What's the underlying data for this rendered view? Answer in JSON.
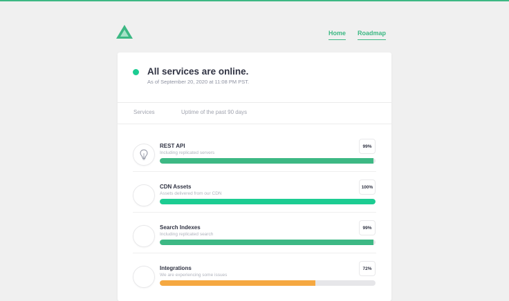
{
  "colors": {
    "accent": "#3db884",
    "online": "#1ccc92",
    "warning": "#f5a841"
  },
  "nav": {
    "home": "Home",
    "roadmap": "Roadmap"
  },
  "status": {
    "title": "All services are online.",
    "subtitle": "As of September 20, 2020 at 11:08 PM PST."
  },
  "table": {
    "col_services": "Services",
    "col_uptime": "Uptime of the past 90 days"
  },
  "services": [
    {
      "name": "REST API",
      "description": "Including replicated servers",
      "uptime_label": "99%",
      "uptime": 0.99,
      "color": "#3db884",
      "icon": "lightbulb-icon"
    },
    {
      "name": "CDN Assets",
      "description": "Assets delivered from our CDN",
      "uptime_label": "100%",
      "uptime": 1.0,
      "color": "#1ccc92",
      "icon": ""
    },
    {
      "name": "Search Indexes",
      "description": "Including replicated search",
      "uptime_label": "99%",
      "uptime": 0.99,
      "color": "#3db884",
      "icon": ""
    },
    {
      "name": "Integrations",
      "description": "We are experiencing some issues",
      "uptime_label": "72%",
      "uptime": 0.72,
      "color": "#f5a841",
      "icon": ""
    }
  ]
}
